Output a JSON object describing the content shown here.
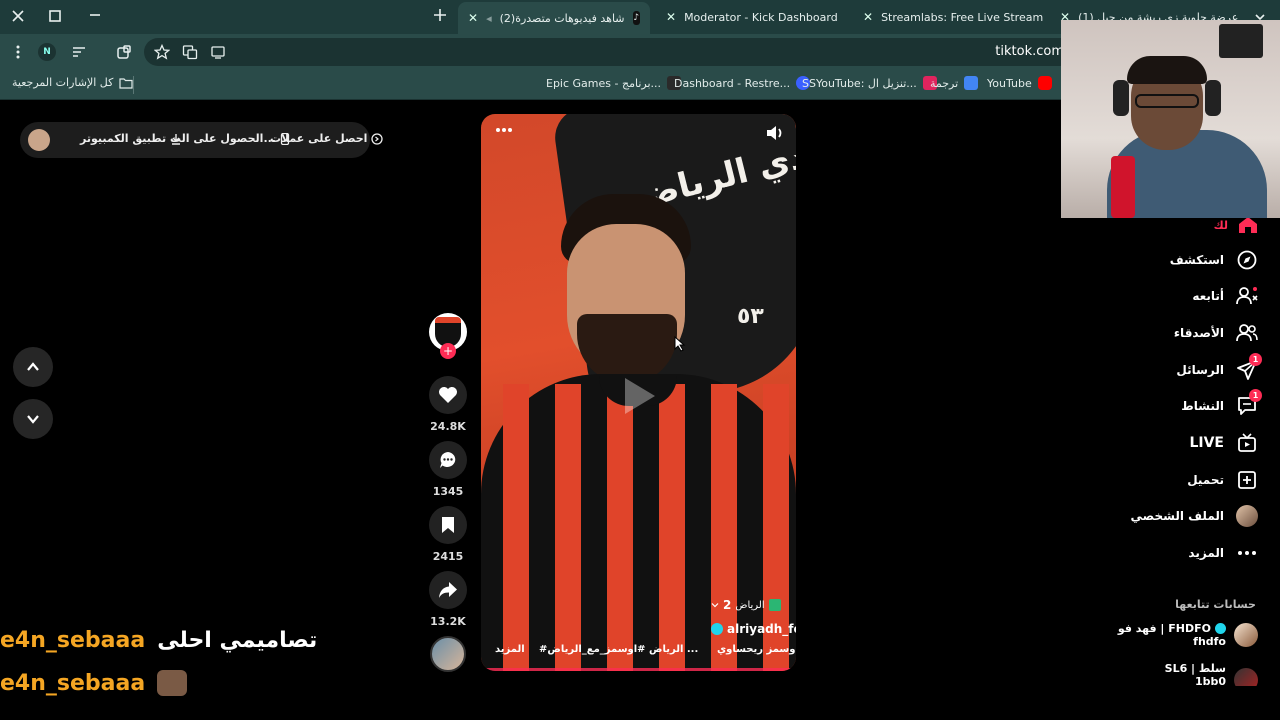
{
  "browser": {
    "tabs": [
      {
        "title": "(2)شاهد فيديوهات متصدرة",
        "active": true
      },
      {
        "title": "Moderator - Kick Dashboard"
      },
      {
        "title": "Streamlabs: Free Live Streaming"
      },
      {
        "title": "(1) عرضة جلوية زى ريشة من جبل"
      }
    ],
    "url": "tiktok.com",
    "profile_initial": "N",
    "bookmarks": {
      "all_label": "كل الإشارات المرجعية",
      "items": [
        "Epic Games - برنامج...",
        "Dashboard - Restre...",
        "SSYouTube: تنزيل ال...",
        "ترجمة",
        "YouTube"
      ]
    }
  },
  "tiktok_topbar": {
    "coins": "احصل على عملات",
    "get_app": "الحصول على الت...",
    "desktop_app": "تطبيق الكمبيوتر"
  },
  "video": {
    "channel": "alriyadh_fc",
    "location": "الرياض",
    "part": "2",
    "caption_user": "أوسمز ريحساوي",
    "hashtags": "#الرياض  #اوسمز_مع_الرياض  ...",
    "more": "المزيد",
    "background_text": "نادي الرياض",
    "badge_text": "٥٣"
  },
  "actions": {
    "likes": "24.8K",
    "comments": "1345",
    "saves": "2415",
    "shares": "13.2K"
  },
  "sidebar": {
    "top_label": "لك",
    "items": [
      {
        "label": "استكشف",
        "icon": "compass-icon"
      },
      {
        "label": "أتابعه",
        "icon": "user-follow-icon"
      },
      {
        "label": "الأصدقاء",
        "icon": "friends-icon"
      },
      {
        "label": "الرسائل",
        "icon": "send-icon",
        "badge": "1"
      },
      {
        "label": "النشاط",
        "icon": "activity-icon",
        "badge": "1"
      },
      {
        "label": "LIVE",
        "icon": "live-icon"
      },
      {
        "label": "تحميل",
        "icon": "upload-icon"
      },
      {
        "label": "الملف الشخصي",
        "icon": "profile-avatar"
      },
      {
        "label": "المزيد",
        "icon": "more-icon"
      }
    ],
    "following_title": "حسابات تتابعها",
    "following": [
      {
        "name": "فهد فو | FHDFO",
        "handle": "fhdfo"
      },
      {
        "name": "SL6 | سلط",
        "handle": "1bb0"
      }
    ]
  },
  "chat": [
    {
      "user": "e4n_sebaaa",
      "message": "تصاميمي احلى"
    },
    {
      "user": "e4n_sebaaa",
      "message": ""
    }
  ],
  "colors": {
    "accent": "#fe2c55",
    "chrome": "#2a4b49",
    "chat_user": "#f5a623"
  }
}
